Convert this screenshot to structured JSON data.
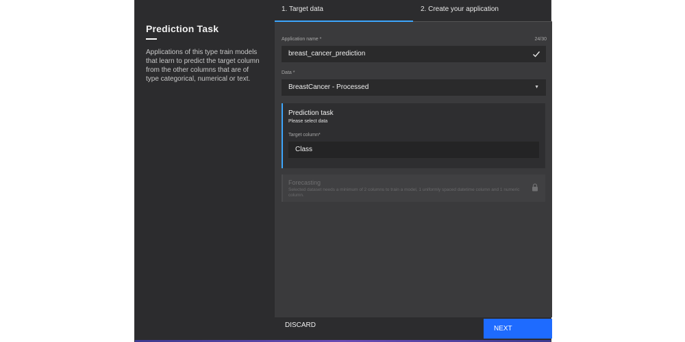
{
  "info": {
    "title": "Prediction Task",
    "description": "Applications of this type train models that learn to predict the target column from the other columns that are of type categorical, numerical or text."
  },
  "stepper": {
    "steps": [
      "1. Target data",
      "2. Create your application"
    ],
    "active_step": 1
  },
  "form": {
    "app_name_label": "Application name *",
    "app_name_count": "24/30",
    "app_name_value": "breast_cancer_prediction",
    "data_label": "Data *",
    "data_value": "BreastCancer - Processed"
  },
  "prediction_card": {
    "title": "Prediction task",
    "subtitle": "Please select data",
    "target_label": "Target column*",
    "target_value": "Class"
  },
  "forecast_card": {
    "title": "Forecasting",
    "description": "Selected dataset needs a minimum of 2 columns to train a model, 1 uniformly spaced datetime column and 1 numeric column."
  },
  "footer": {
    "discard_label": "DISCARD",
    "next_label": "NEXT"
  },
  "colors": {
    "accent": "#3da7ff",
    "primary_button": "#1e6bff",
    "background": "#2c2c2e"
  }
}
